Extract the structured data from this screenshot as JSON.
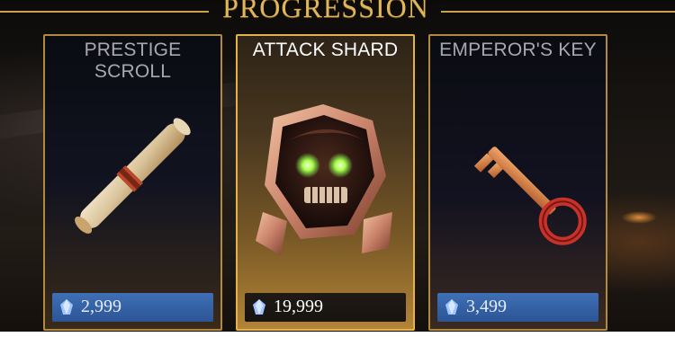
{
  "header": {
    "title": "PROGRESSION"
  },
  "cards": [
    {
      "title": "PRESTIGE SCROLL",
      "price": "2,999",
      "icon": "scroll-icon",
      "selected": false
    },
    {
      "title": "ATTACK SHARD",
      "price": "19,999",
      "icon": "attack-shard-icon",
      "selected": true
    },
    {
      "title": "EMPEROR'S KEY",
      "price": "3,499",
      "icon": "key-icon",
      "selected": false
    }
  ],
  "currency": {
    "icon": "gem-icon"
  },
  "colors": {
    "accent_gold": "#e0b65a",
    "price_blue": "#3f6fb5"
  }
}
